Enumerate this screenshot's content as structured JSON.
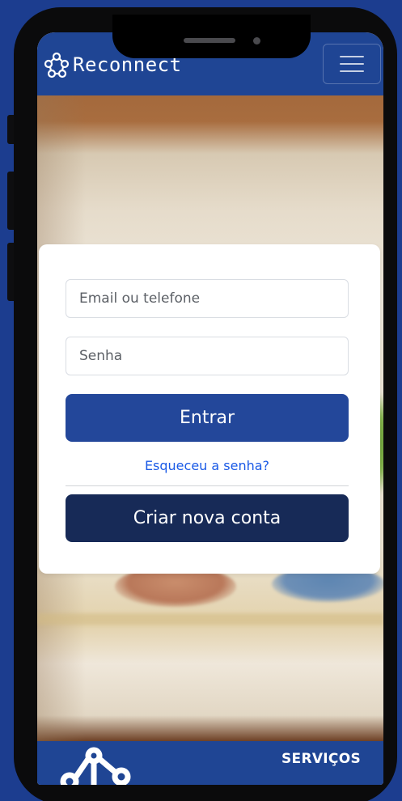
{
  "navbar": {
    "brand_name": "Reconnect",
    "brand_icon": "network-logo-icon",
    "menu_icon": "hamburger-menu-icon"
  },
  "login": {
    "email_placeholder": "Email ou telefone",
    "password_placeholder": "Senha",
    "submit_label": "Entrar",
    "forgot_link": "Esqueceu a senha?",
    "create_account_label": "Criar nova conta"
  },
  "footer": {
    "heading": "SERVIÇOS",
    "logo_icon": "network-logo-icon"
  },
  "colors": {
    "background": "#1c3d8f",
    "navbar": "#1f4594",
    "primary_button": "#23479a",
    "secondary_button": "#172a57",
    "link": "#1a5ae6"
  }
}
